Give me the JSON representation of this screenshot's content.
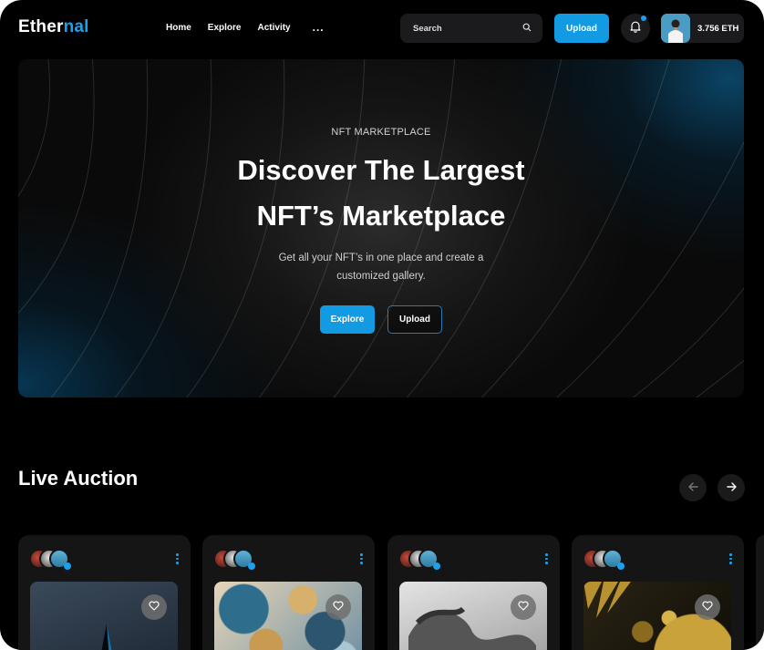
{
  "header": {
    "logo_main": "Ether",
    "logo_accent": "nal",
    "nav": [
      "Home",
      "Explore",
      "Activity"
    ],
    "more": "...",
    "search_placeholder": "Search",
    "upload": "Upload",
    "balance": "3.756 ETH"
  },
  "hero": {
    "kicker": "NFT MARKETPLACE",
    "title_line1": "Discover The Largest",
    "title_line2": "NFT’s Marketplace",
    "subtitle_line1": "Get all your NFT’s in one place and create a",
    "subtitle_line2": "customized gallery.",
    "explore": "Explore",
    "upload": "Upload"
  },
  "live_auction": {
    "title": "Live Auction"
  },
  "colors": {
    "accent": "#129ae3",
    "background": "#000000",
    "card": "#151515"
  },
  "icons": [
    "search-icon",
    "bell-icon",
    "arrow-left-icon",
    "arrow-right-icon",
    "heart-icon",
    "more-vertical-icon",
    "verified-icon"
  ]
}
